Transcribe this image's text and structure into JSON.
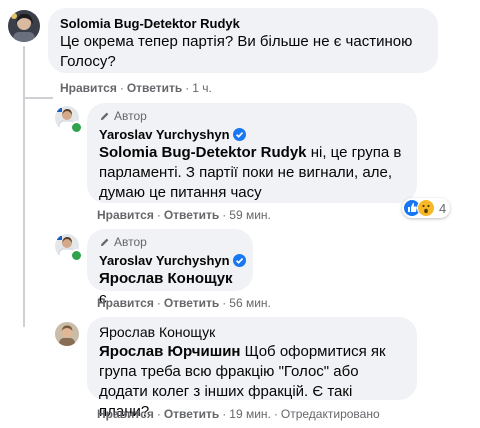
{
  "comments": [
    {
      "author": "Solomia Bug-Detektor Rudyk",
      "text": "Це окрема тепер партія? Ви більше не є частиною Голосу?",
      "like": "Нравится",
      "reply": "Ответить",
      "time": "1 ч."
    },
    {
      "badge": "Автор",
      "author": "Yaroslav Yurchyshyn",
      "mention": "Solomia Bug-Detektor Rudyk",
      "text": " ні, це група в парламенті. З партії поки не вигнали, але, думаю це питання часу",
      "like": "Нравится",
      "reply": "Ответить",
      "time": "59 мин.",
      "reaction_count": "4"
    },
    {
      "badge": "Автор",
      "author": "Yaroslav Yurchyshyn",
      "mention": "Ярослав Конощук",
      "text": " є",
      "like": "Нравится",
      "reply": "Ответить",
      "time": "56 мин."
    },
    {
      "author": "Ярослав Конощук",
      "mention": "Ярослав Юрчишин",
      "text": " Щоб оформитися як група треба всю фракцію \"Голос\" або додати колег з інших фракцій. Є такі плани?",
      "like": "Нравится",
      "reply": "Ответить",
      "time": "19 мин.",
      "edited": "Отредактировано"
    }
  ],
  "colors": {
    "bubble": "#f0f2f5",
    "meta": "#65676b",
    "verified": "#1877f2",
    "online": "#31a24c"
  }
}
